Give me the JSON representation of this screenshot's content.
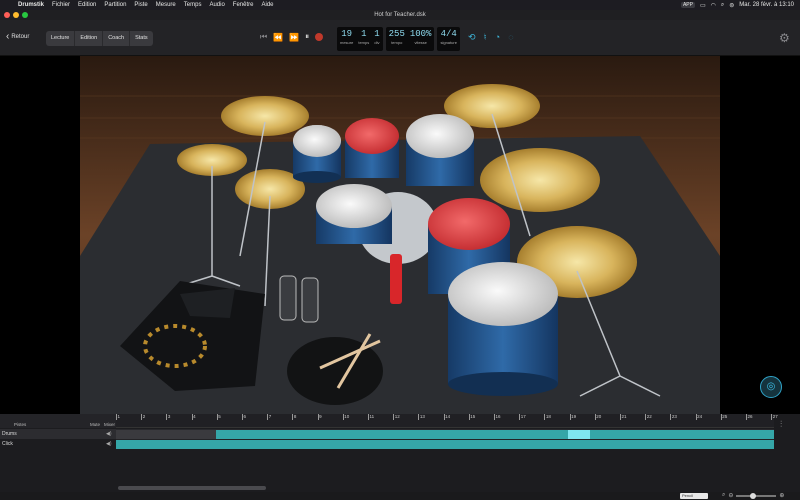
{
  "menubar": {
    "app": "Drumstik",
    "items": [
      "Fichier",
      "Edition",
      "Partition",
      "Piste",
      "Mesure",
      "Temps",
      "Audio",
      "Fenêtre",
      "Aide"
    ],
    "status_badge": "APP",
    "datetime": "Mar. 28 févr. à 13:10"
  },
  "window": {
    "title": "Hot for Teacher.dsk"
  },
  "toolbar": {
    "back_label": "Retour",
    "modes": [
      "Lecture",
      "Edition",
      "Coach",
      "Stats"
    ],
    "counters": {
      "mesure": {
        "value": "19",
        "label": "mesure"
      },
      "temps": {
        "value": "1",
        "label": "temps"
      },
      "div": {
        "value": "1",
        "label": "div"
      },
      "tempo": {
        "value": "255",
        "label": "tempo"
      },
      "vitesse": {
        "value": "100%",
        "label": "vitesse"
      },
      "signature": {
        "value": "4/4",
        "label": "signature"
      }
    }
  },
  "tracks": {
    "header": {
      "pistes": "Pistes",
      "mute": "Mute",
      "mixer": "Mixer"
    },
    "rows": [
      {
        "name": "Drums"
      },
      {
        "name": "Click"
      }
    ],
    "ruler": [
      "1",
      "2",
      "3",
      "4",
      "5",
      "6",
      "7",
      "8",
      "9",
      "10",
      "11",
      "12",
      "13",
      "14",
      "15",
      "16",
      "17",
      "18",
      "19",
      "20",
      "21",
      "22",
      "23",
      "24",
      "25",
      "26",
      "27"
    ],
    "pen_label": "Pencil"
  },
  "colors": {
    "accent": "#2fa3c8",
    "track_teal": "#35a6a8",
    "record": "#c0392b",
    "drum_red": "#d8393d",
    "shell_blue": "#1f4f86"
  }
}
